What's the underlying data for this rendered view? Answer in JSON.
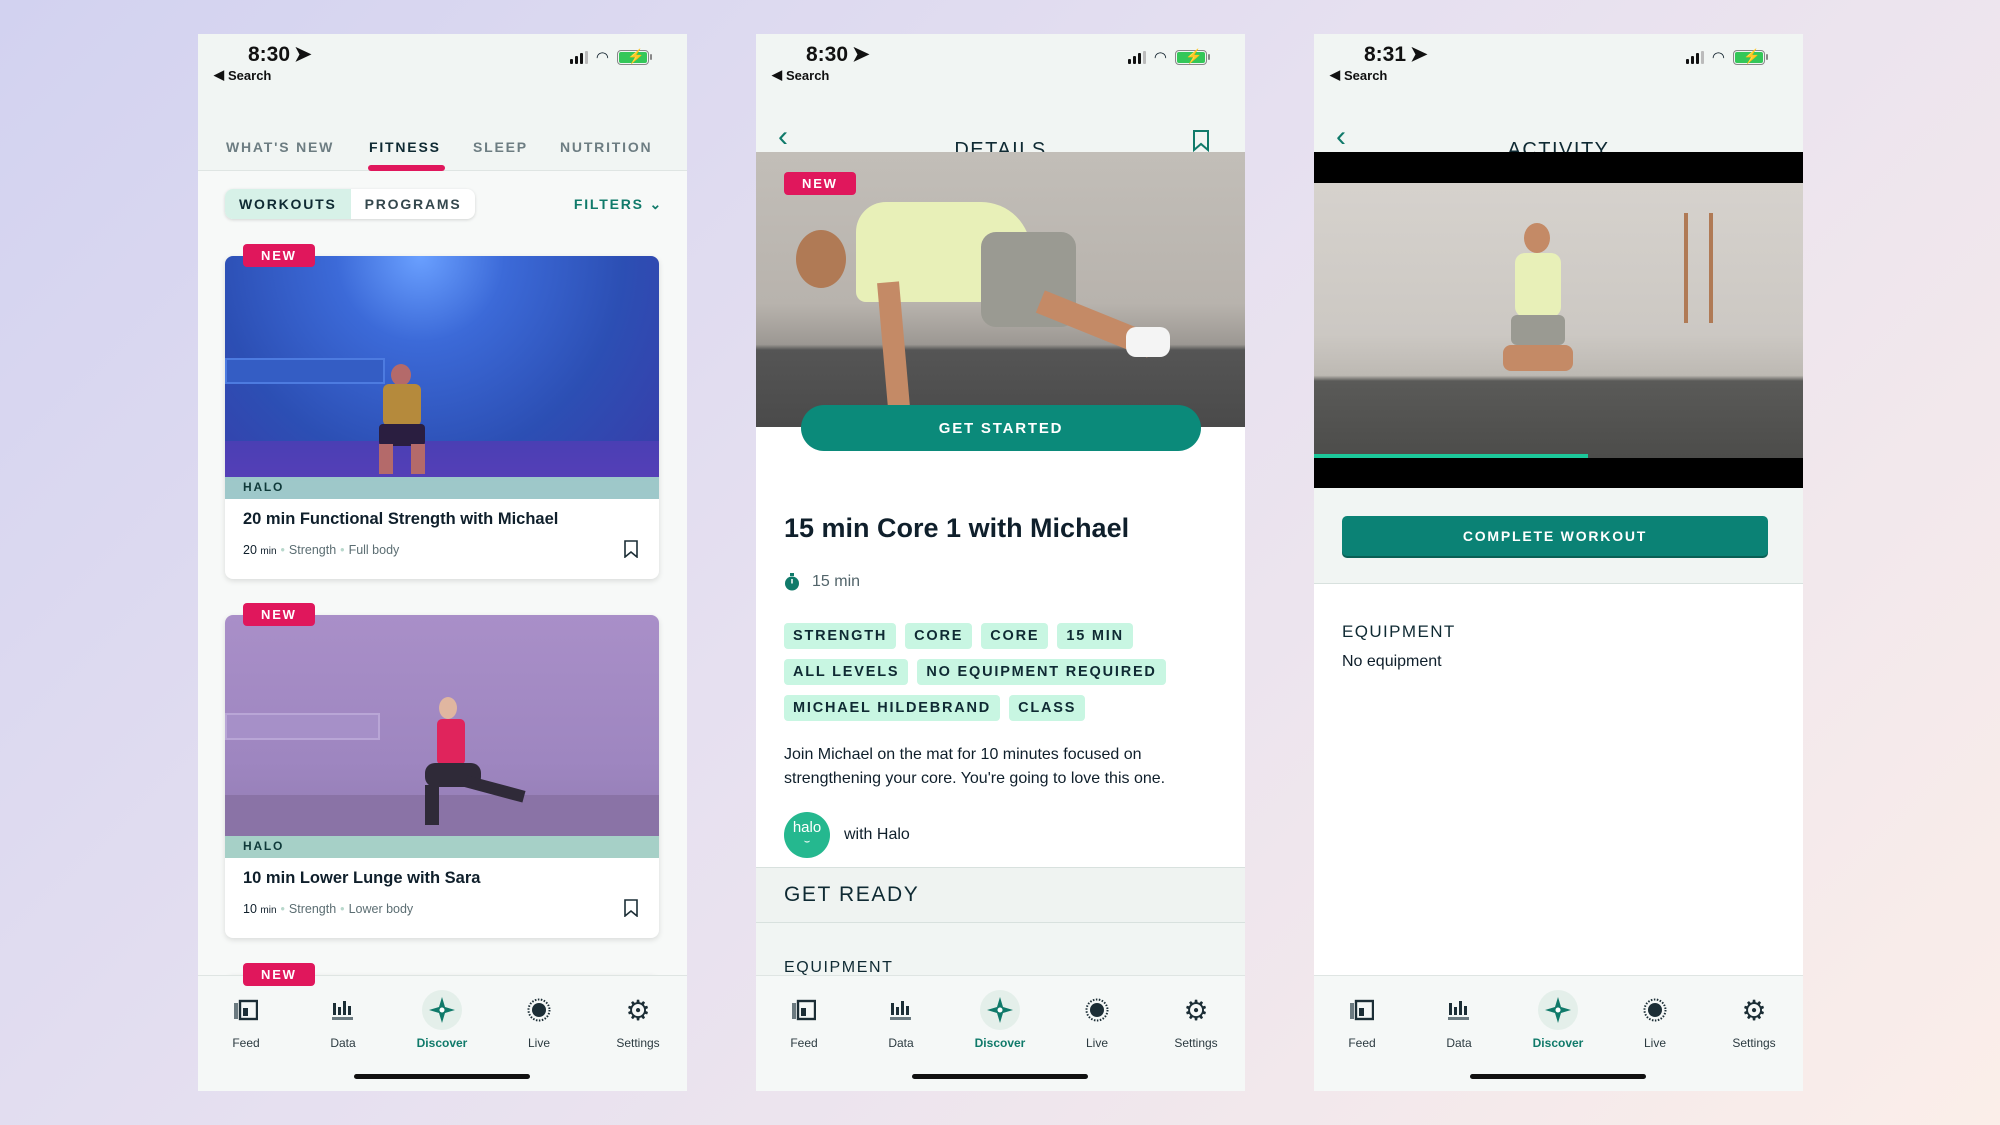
{
  "colors": {
    "accent": "#107a6a",
    "button": "#0b8a7a",
    "badge": "#e0175c",
    "tag_bg": "#c8f6e2",
    "progress": "#1cc79a"
  },
  "status_bars": [
    {
      "time": "8:30",
      "back_label": "Search"
    },
    {
      "time": "8:30",
      "back_label": "Search"
    },
    {
      "time": "8:31",
      "back_label": "Search"
    }
  ],
  "fitness": {
    "tabs": [
      {
        "label": "WHAT'S NEW",
        "active": false
      },
      {
        "label": "FITNESS",
        "active": true
      },
      {
        "label": "SLEEP",
        "active": false
      },
      {
        "label": "NUTRITION",
        "active": false
      }
    ],
    "segments": [
      {
        "label": "WORKOUTS",
        "active": true
      },
      {
        "label": "PROGRAMS",
        "active": false
      }
    ],
    "filters_label": "FILTERS",
    "cards": [
      {
        "badge": "NEW",
        "provider": "HALO",
        "title": "20 min Functional Strength with Michael",
        "duration": "20",
        "unit": "min",
        "category": "Strength",
        "focus": "Full body"
      },
      {
        "badge": "NEW",
        "provider": "HALO",
        "title": "10 min Lower Lunge with Sara",
        "duration": "10",
        "unit": "min",
        "category": "Strength",
        "focus": "Lower body"
      },
      {
        "badge": "NEW"
      }
    ]
  },
  "details": {
    "header_title": "DETAILS",
    "save_label": "Save",
    "badge": "NEW",
    "get_started_label": "GET STARTED",
    "title": "15 min Core 1 with Michael",
    "duration": "15 min",
    "tags": [
      "STRENGTH",
      "CORE",
      "CORE",
      "15 MIN",
      "ALL LEVELS",
      "NO EQUIPMENT REQUIRED",
      "MICHAEL HILDEBRAND",
      "CLASS"
    ],
    "description": "Join Michael on the mat for 10 minutes focused on strengthening your core. You're going to love this one.",
    "provider_logo": "halo",
    "provider_label": "with Halo",
    "section_title": "GET READY",
    "equipment_heading": "EQUIPMENT"
  },
  "activity": {
    "header_title": "ACTIVITY",
    "video_progress": 0.56,
    "complete_label": "COMPLETE WORKOUT",
    "equipment_heading": "EQUIPMENT",
    "equipment_value": "No equipment"
  },
  "nav": {
    "items": [
      {
        "label": "Feed",
        "icon": "feed-icon"
      },
      {
        "label": "Data",
        "icon": "data-icon"
      },
      {
        "label": "Discover",
        "icon": "discover-icon",
        "active": true
      },
      {
        "label": "Live",
        "icon": "live-icon"
      },
      {
        "label": "Settings",
        "icon": "settings-icon"
      }
    ]
  }
}
